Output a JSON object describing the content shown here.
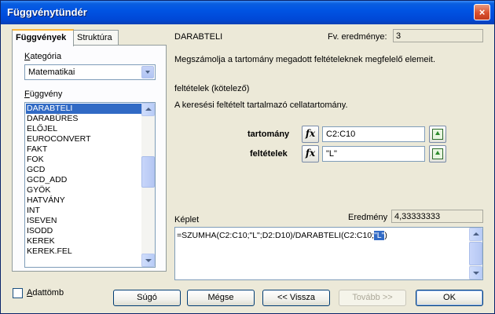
{
  "window": {
    "title": "Függvénytündér"
  },
  "tabs": [
    {
      "label": "Függvények"
    },
    {
      "label": "Struktúra"
    }
  ],
  "category": {
    "label": "Kategória",
    "label_rest": "ategória",
    "label_key": "K",
    "value": "Matematikai"
  },
  "function_list": {
    "label": "Függvény",
    "label_key": "F",
    "label_rest": "üggvény",
    "items": [
      "DARABTELI",
      "DARABÜRES",
      "ELŐJEL",
      "EUROCONVERT",
      "FAKT",
      "FOK",
      "GCD",
      "GCD_ADD",
      "GYÖK",
      "HATVÁNY",
      "INT",
      "ISEVEN",
      "ISODD",
      "KEREK",
      "KEREK.FEL"
    ],
    "selected": "DARABTELI"
  },
  "function_info": {
    "name": "DARABTELI",
    "result_label": "Fv. eredménye:",
    "result_value": "3",
    "description": "Megszámolja a tartomány megadott feltételeknek megfelelő elemeit.",
    "param_title": "feltételek (kötelező)",
    "param_description": "A keresési feltételt tartalmazó cellatartomány."
  },
  "arguments": [
    {
      "label": "tartomány",
      "value": "C2:C10"
    },
    {
      "label": "feltételek",
      "value": "\"L\""
    }
  ],
  "formula": {
    "label": "Képlet",
    "result_label": "Eredmény",
    "result_value": "4,33333333",
    "text_before": "=SZUMHA(C2:C10;\"L\";D2:D10)/DARABTELI(C2:C10;",
    "text_selected": "\"L\"",
    "text_after": ")"
  },
  "array_checkbox": {
    "label": "Adattömb",
    "label_key": "A",
    "label_rest": "dattömb"
  },
  "buttons": {
    "help": "Súgó",
    "cancel": "Mégse",
    "back": "<< Vissza",
    "next": "Tovább >>",
    "ok": "OK"
  },
  "icons": {
    "fx": "fx",
    "close": "×"
  },
  "colors": {
    "title_bar": "#0054e3",
    "selection": "#316ac5",
    "tab_accent": "#f9b43a"
  }
}
